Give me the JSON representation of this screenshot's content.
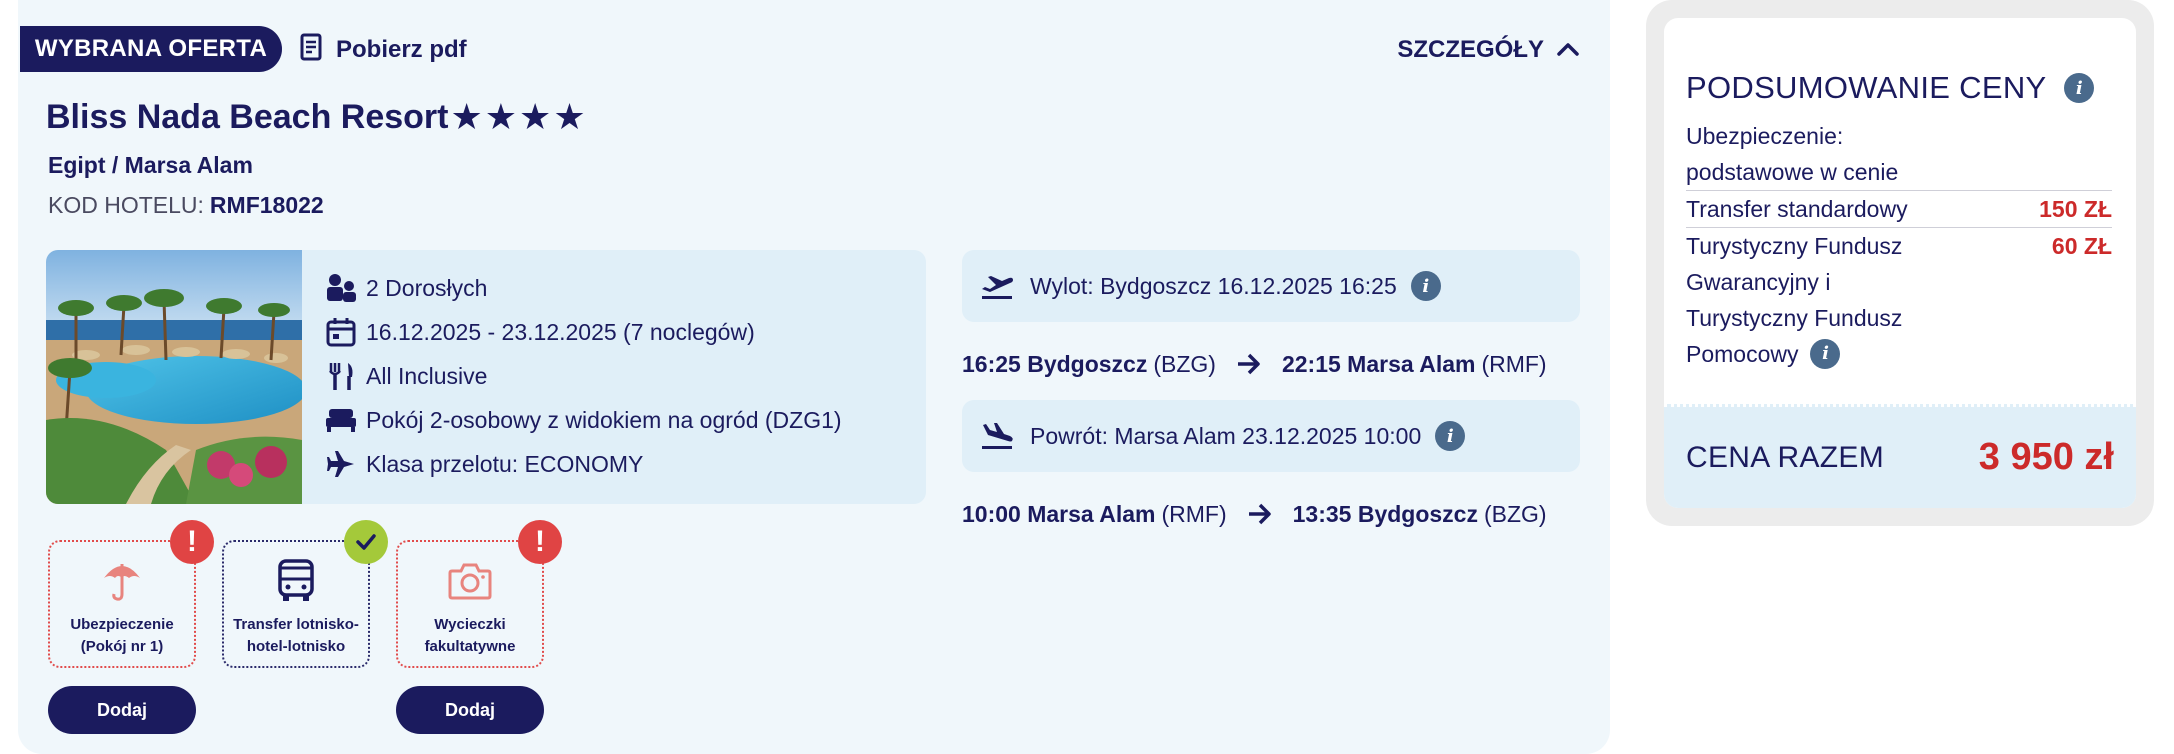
{
  "offer": {
    "badge": "WYBRANA OFERTA",
    "pdf_label": "Pobierz pdf",
    "details_label": "SZCZEGÓŁY",
    "hotel_name": "Bliss Nada Beach Resort",
    "stars": "★★★★",
    "star_count": 4,
    "location": "Egipt / Marsa Alam",
    "hotel_code_label": "KOD HOTELU:",
    "hotel_code": "RMF18022",
    "info": {
      "people": "2 Dorosłych",
      "dates": "16.12.2025 - 23.12.2025 (7 noclegów)",
      "board": "All Inclusive",
      "room": "Pokój 2-osobowy z widokiem na ogród (DZG1)",
      "flight_class": "Klasa przelotu: ECONOMY"
    },
    "outbound": {
      "label": "Wylot: Bydgoszcz 16.12.2025 16:25",
      "dep_time": "16:25 Bydgoszcz",
      "dep_code": "(BZG)",
      "arr_time": "22:15 Marsa Alam",
      "arr_code": "(RMF)"
    },
    "return": {
      "label": "Powrót: Marsa Alam 23.12.2025 10:00",
      "dep_time": "10:00 Marsa Alam",
      "dep_code": "(RMF)",
      "arr_time": "13:35 Bydgoszcz",
      "arr_code": "(BZG)"
    },
    "services": [
      {
        "line1": "Ubezpieczenie",
        "line2": "(Pokój nr 1)",
        "status": "warning",
        "status_symbol": "!",
        "icon": "umbrella-icon",
        "button": "Dodaj"
      },
      {
        "line1": "Transfer lotnisko-",
        "line2": "hotel-lotnisko",
        "status": "included",
        "status_symbol": "✓",
        "icon": "bus-icon",
        "button": ""
      },
      {
        "line1": "Wycieczki",
        "line2": "fakultatywne",
        "status": "warning",
        "status_symbol": "!",
        "icon": "camera-icon",
        "button": "Dodaj"
      }
    ]
  },
  "summary": {
    "title": "PODSUMOWANIE CENY",
    "info_symbol": "i",
    "rows": [
      {
        "line1": "Ubezpieczenie:",
        "line2": "podstawowe w cenie",
        "price": ""
      },
      {
        "line1": "Transfer standardowy",
        "price": "150 ZŁ"
      },
      {
        "line1": "Turystyczny Fundusz",
        "line2": "Gwarancyjny i",
        "line3": "Turystyczny Fundusz",
        "line4": "Pomocowy",
        "price": "60 ZŁ"
      }
    ],
    "total_label": "CENA RAZEM",
    "total_value": "3 950 zł"
  },
  "colors": {
    "navy": "#1b1b5e",
    "accent_red": "#cc2a2a",
    "warning_red": "#e04444",
    "success_green": "#a4c93a",
    "panel_bg": "#f0f7fb",
    "box_bg": "#e0eff8"
  }
}
